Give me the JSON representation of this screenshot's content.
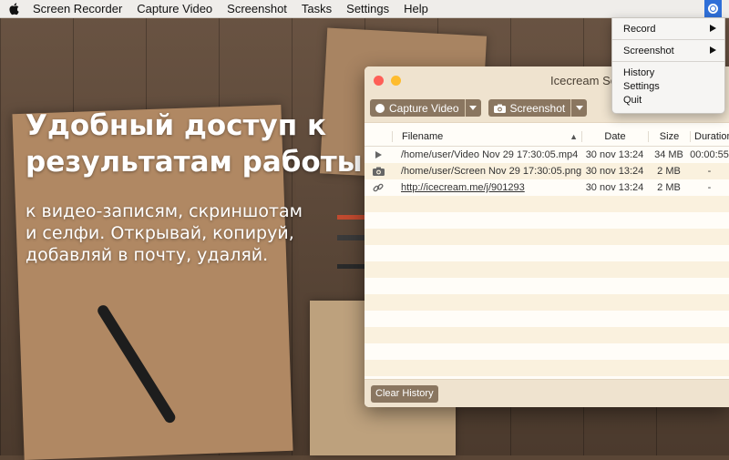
{
  "menubar": {
    "items": [
      "Screen Recorder",
      "Capture Video",
      "Screenshot",
      "Tasks",
      "Settings",
      "Help"
    ]
  },
  "promo": {
    "headline": "Удобный доступ к результатам работы",
    "subline": "к видео-записям, скриншотам и селфи. Открывай, копируй, добавляй в почту, удаляй."
  },
  "window": {
    "title": "Icecream Screen Recorder",
    "toolbar": {
      "capture_video_label": "Capture Video",
      "screenshot_label": "Screenshot"
    },
    "table": {
      "headers": {
        "filename": "Filename",
        "date": "Date",
        "size": "Size",
        "duration": "Duration"
      },
      "rows": [
        {
          "type": "video",
          "icon": "play-icon",
          "filename": "/home/user/Video Nov 29 17:30:05.mp4",
          "date": "30 nov 13:24",
          "size": "34 MB",
          "duration": "00:00:55"
        },
        {
          "type": "screenshot",
          "icon": "camera-icon",
          "filename": "/home/user/Screen Nov 29 17:30:05.png",
          "date": "30 nov 13:24",
          "size": "2 MB",
          "duration": "-"
        },
        {
          "type": "link",
          "icon": "link-icon",
          "filename": "http://icecream.me/j/901293",
          "date": "30 nov 13:24",
          "size": "2 MB",
          "duration": "-"
        }
      ]
    },
    "footer": {
      "clear_label": "Clear History"
    }
  },
  "dropdown": {
    "record": "Record",
    "screenshot": "Screenshot",
    "history": "History",
    "settings": "Settings",
    "quit": "Quit"
  },
  "colors": {
    "accent_blue": "#2f6fd8",
    "button_brown": "#8a7660",
    "window_chrome": "#efe3cf",
    "row_stripe": "#faf1de"
  }
}
